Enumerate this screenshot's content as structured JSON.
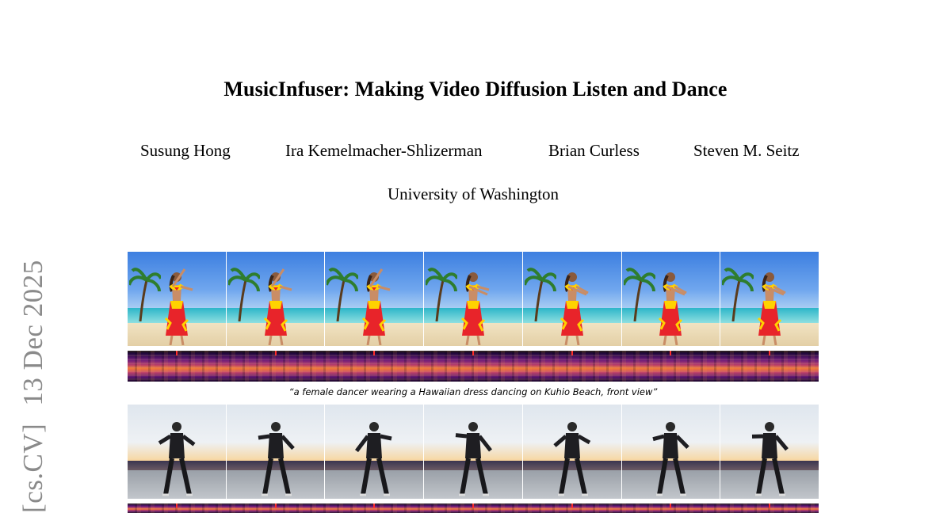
{
  "paper": {
    "title": "MusicInfuser: Making Video Diffusion Listen and Dance",
    "authors": [
      "Susung Hong",
      "Ira Kemelmacher-Shlizerman",
      "Brian Curless",
      "Steven M. Seitz"
    ],
    "affiliation": "University of Washington"
  },
  "arxiv_stamp": {
    "category": "[cs.CV]",
    "date": "13 Dec 2025"
  },
  "figure": {
    "rows": [
      {
        "scene": "beach",
        "frames": 7,
        "caption": "“a female dancer wearing a Hawaiian dress dancing on Kuhio Beach, front view”"
      },
      {
        "scene": "sunset-rooftop",
        "frames": 7,
        "caption": ""
      }
    ],
    "colors": {
      "beat_marker": "#ff2a2a",
      "spectrogram_low": "#1a0628",
      "spectrogram_high": "#f07a3a"
    }
  }
}
